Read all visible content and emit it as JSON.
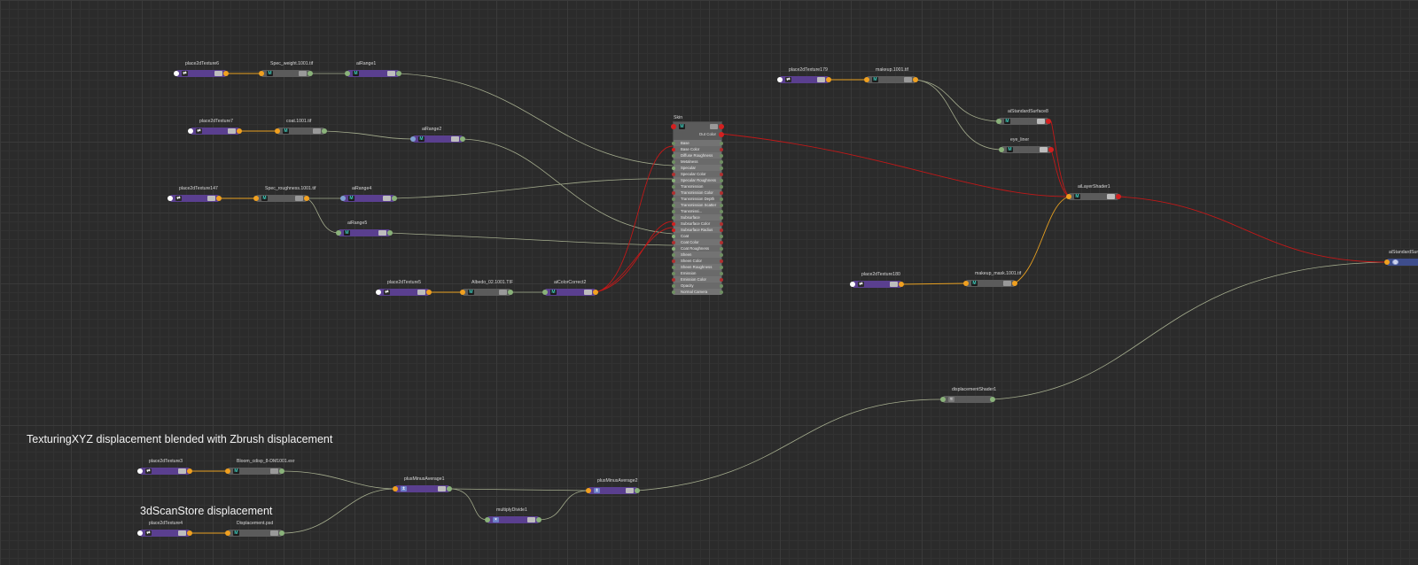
{
  "annotations": {
    "texturing_note": "TexturingXYZ displacement blended with Zbrush displacement",
    "scanstore_note": "3dScanStore displacement"
  },
  "nodes": {
    "place2dTexture6": "place2dTexture6",
    "spec_weight": "Spec_weight.1001.tif",
    "aiRange1": "aiRange1",
    "place2dTexture7": "place2dTexture7",
    "coat": "coat.1001.tif",
    "aiRange2": "aiRange2",
    "place2dTexture147": "place2dTexture147",
    "spec_roughness": "Spec_roughness.1001.tif",
    "aiRange4": "aiRange4",
    "aiRange5": "aiRange5",
    "place2dTexture5": "place2dTexture5",
    "albedo": "Albedo_02.1001.TIF",
    "aiColorCorrect2": "aiColorCorrect2",
    "place2dTexture179": "place2dTexture179",
    "makeup": "makeup.1001.tif",
    "aiStandardSurface8": "aiStandardSurface8",
    "eye_liner": "eye_liner",
    "aiLayerShader1": "aiLayerShader1",
    "place2dTexture180": "place2dTexture180",
    "makeup_mask": "makeup_mask.1001.tif",
    "aiStandardSurface_out": "aiStandardSurfa",
    "displacementShader1": "displacementShader1",
    "place2dTexture3": "place2dTexture3",
    "bloom": "Bloom_cdisp_8-DM1001.exr",
    "plusMinusAverage1": "plusMinusAverage1",
    "plusMinusAverage2": "plusMinusAverage2",
    "multiplyDivide1": "multiplyDivide1",
    "place2dTexture4": "place2dTexture4",
    "displacement": "Displacement.psd"
  },
  "skin_shader": {
    "title": "Skin",
    "out_label": "Out Color",
    "attributes": [
      "Base",
      "Base Color",
      "Diffuse Roughness",
      "Metalness",
      "Specular",
      "Specular Color",
      "Specular Roughness",
      "Transmission",
      "Transmission Color",
      "Transmission Depth",
      "Transmission Scatter",
      "Transmissi... Roughness",
      "Subsurface",
      "Subsurface Color",
      "Subsurface Radius",
      "Coat",
      "Coat Color",
      "Coat Roughness",
      "Sheen",
      "Sheen Color",
      "Sheen Roughness",
      "Emission",
      "Emission Color",
      "Opacity",
      "Normal Camera"
    ],
    "connected_attributes": [
      "Base Color",
      "Specular",
      "Specular Roughness",
      "Subsurface Color",
      "Subsurface Radius",
      "Coat",
      "Coat Roughness"
    ]
  },
  "colors": {
    "background": "#2b2b2b",
    "wire_float": "#a5ad8e",
    "wire_color": "#c01818",
    "wire_uv": "#e8a020",
    "utility_node": "#5a3f8f",
    "file_node": "#5b5b5b",
    "output_node": "#3e4d8c"
  }
}
